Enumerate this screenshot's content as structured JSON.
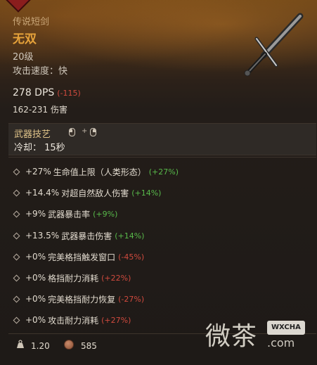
{
  "item": {
    "rarity": "传说短剑",
    "name": "无双",
    "level": "20级",
    "attack_speed": "攻击速度：快"
  },
  "stats": {
    "dps": "278 DPS",
    "dps_diff": "(-115)",
    "damage": "162-231 伤害"
  },
  "skill": {
    "title": "武器技艺",
    "plus": "+",
    "cooldown": "冷却： 15秒"
  },
  "affixes": [
    {
      "value": "+27%",
      "label": "生命值上限（人类形态）",
      "bonus": "(+27%)",
      "bonus_type": "pos"
    },
    {
      "value": "+14.4%",
      "label": "对超自然敌人伤害",
      "bonus": "(+14%)",
      "bonus_type": "pos"
    },
    {
      "value": "+9%",
      "label": "武器暴击率",
      "bonus": "(+9%)",
      "bonus_type": "pos"
    },
    {
      "value": "+13.5%",
      "label": "武器暴击伤害",
      "bonus": "(+14%)",
      "bonus_type": "pos"
    },
    {
      "value": "+0%",
      "label": "完美格挡触发窗口",
      "bonus": "(-45%)",
      "bonus_type": "neg"
    },
    {
      "value": "+0%",
      "label": "格挡耐力消耗",
      "bonus": "(+22%)",
      "bonus_type": "neg"
    },
    {
      "value": "+0%",
      "label": "完美格挡耐力恢复",
      "bonus": "(-27%)",
      "bonus_type": "neg"
    },
    {
      "value": "+0%",
      "label": "攻击耐力消耗",
      "bonus": "(+27%)",
      "bonus_type": "neg"
    }
  ],
  "footer": {
    "weight": "1.20",
    "price": "585"
  },
  "watermark": {
    "text": "微茶",
    "badge": "WXCHA",
    "url": ".com"
  },
  "colors": {
    "item_name": "#e6a23a",
    "bonus_positive": "#58b94a",
    "bonus_negative": "#d04a3e"
  },
  "icons": [
    "sword-icon",
    "mouse-left-icon",
    "mouse-right-icon",
    "diamond-bullet-icon",
    "weight-icon",
    "coin-icon"
  ]
}
